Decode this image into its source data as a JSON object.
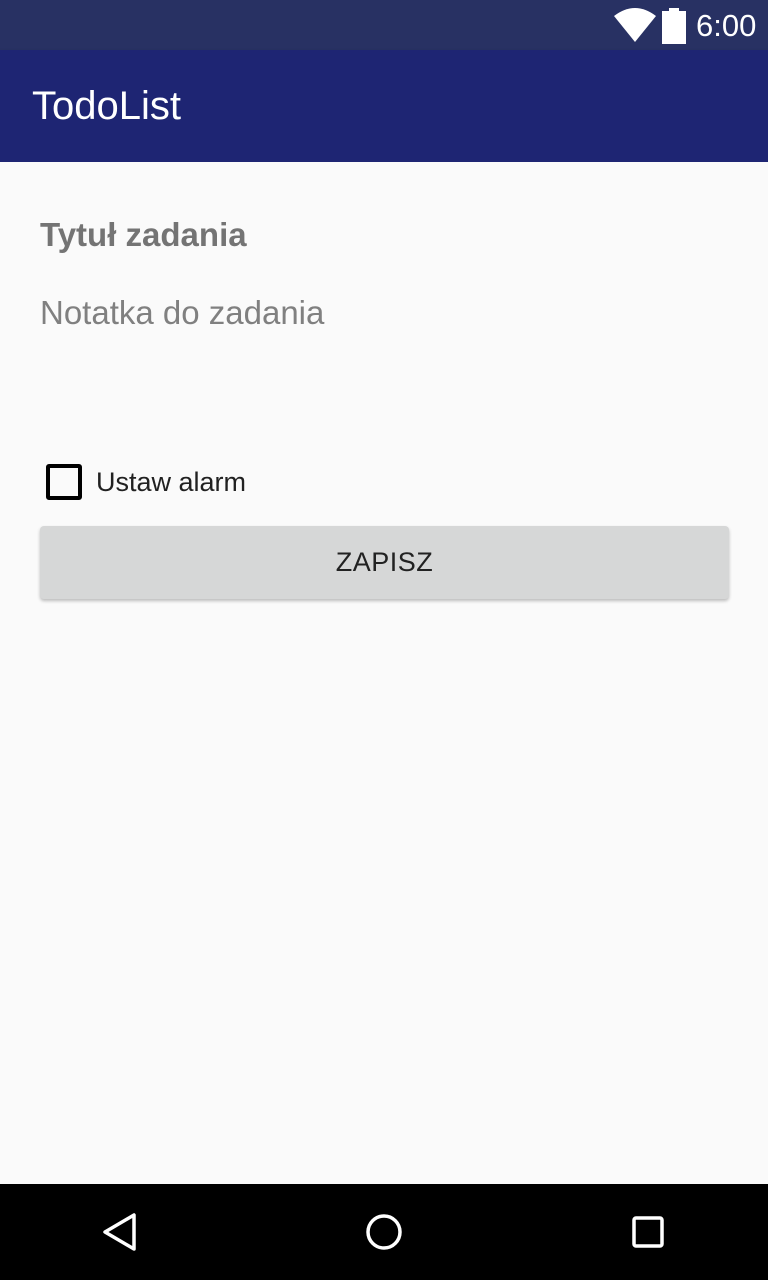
{
  "status_bar": {
    "time": "6:00",
    "icons": [
      "wifi-icon",
      "battery-icon"
    ]
  },
  "app_bar": {
    "title": "TodoList"
  },
  "form": {
    "title_placeholder": "Tytuł zadania",
    "note_placeholder": "Notatka do zadania",
    "alarm_label": "Ustaw alarm",
    "alarm_checked": false,
    "save_label": "ZAPISZ"
  },
  "nav_bar": {
    "icons": [
      "back-icon",
      "home-icon",
      "recents-icon"
    ]
  },
  "colors": {
    "status_bar": "#283163",
    "app_bar": "#1e2573",
    "background": "#fafafa",
    "button": "#d6d7d7"
  }
}
